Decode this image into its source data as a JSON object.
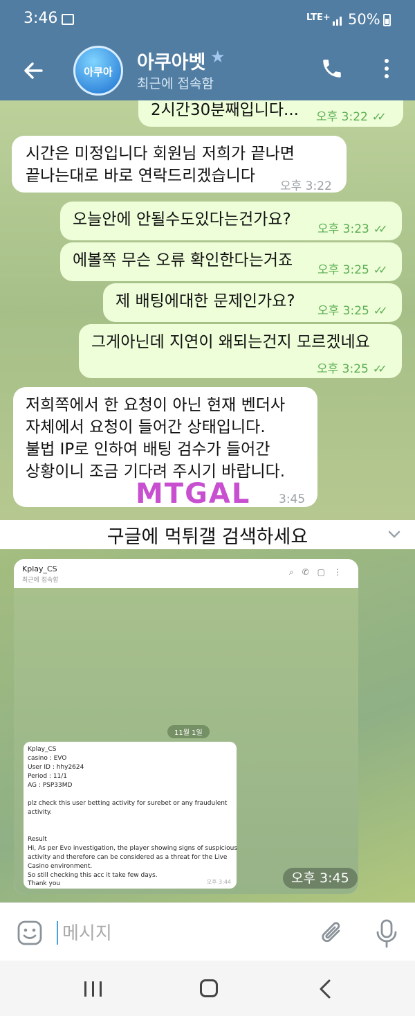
{
  "status_bar": {
    "time": "3:46",
    "network": "LTE+",
    "battery": "50%"
  },
  "header": {
    "title": "아쿠아벳",
    "status": "최근에 접속함",
    "avatar_text": "아쿠아"
  },
  "messages": [
    {
      "dir": "out",
      "text": "2시간30분째입니다...",
      "time": "오후 3:22"
    },
    {
      "dir": "in",
      "lines": [
        "시간은 미정입니다 회원님 저희가 끝나면",
        "끝나는대로 바로 연락드리겠습니다"
      ],
      "time": "오후 3:22"
    },
    {
      "dir": "out",
      "text": "오늘안에 안될수도있다는건가요?",
      "time": "오후 3:23"
    },
    {
      "dir": "out",
      "text": "에볼쪽 무슨 오류 확인한다는거죠",
      "time": "오후 3:25"
    },
    {
      "dir": "out",
      "text": "제 배팅에대한 문제인가요?",
      "time": "오후 3:25"
    },
    {
      "dir": "out",
      "text": "그게아닌데 지연이 왜되는건지 모르겠네요",
      "time": "오후 3:25"
    },
    {
      "dir": "in",
      "lines": [
        "저희쪽에서 한 요청이 아닌 현재 벤더사",
        "자체에서 요청이 들어간 상태입니다.",
        "불법 IP로 인하여 배팅 검수가 들어간",
        "상황이니 조금 기다려 주시기 바랍니다."
      ],
      "time": "3:45"
    }
  ],
  "watermark": "MTGAL",
  "banner": {
    "text": "구글에 먹튀갤 검색하세요"
  },
  "photo": {
    "title": "Kplay_CS",
    "status": "최근에 접속함",
    "date": "11월 1일",
    "lines": [
      "Kplay_CS",
      "casino : EVO",
      "User ID : hhy2624",
      "Period : 11/1",
      "AG : PSP33MD",
      "",
      "plz check this user betting activity for surebet or any fraudulent",
      "activity.",
      "",
      "",
      "Result",
      "Hi, As per Evo investigation, the player showing signs of suspicious",
      "activity and therefore can be considered as a threat for the Live",
      "Casino environment.",
      "So still checking this acc it take few days.",
      "Thank you"
    ],
    "inner_time": "오후 3:44",
    "time": "오후 3:45"
  },
  "input": {
    "placeholder": "메시지"
  },
  "icons": [
    "back-arrow-icon",
    "phone-icon",
    "more-vertical-icon",
    "emoji-icon",
    "attach-icon",
    "mic-icon",
    "star-icon",
    "chevron-down-icon"
  ]
}
